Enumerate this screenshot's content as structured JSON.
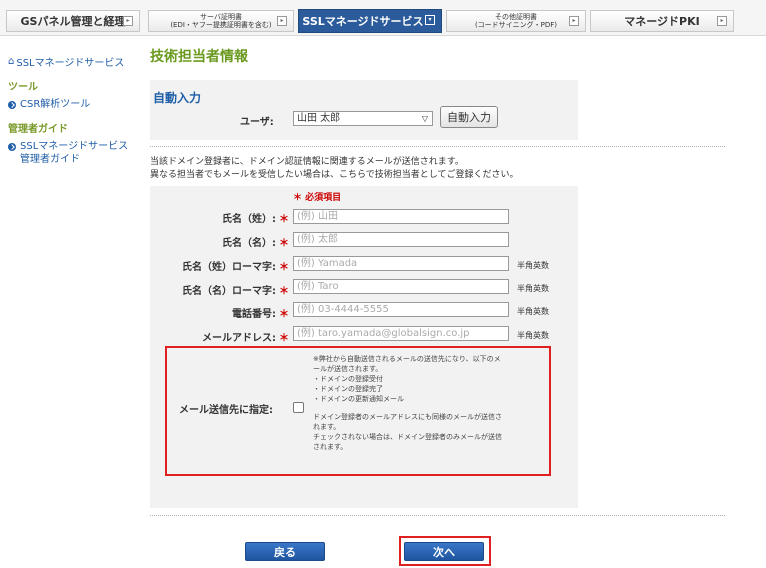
{
  "tabs": [
    {
      "label": "GSパネル管理と経理",
      "small": false,
      "active": false
    },
    {
      "label": "サーバ証明書\n(EDI・ヤフー提携証明書を含む)",
      "small": true,
      "active": false
    },
    {
      "label": "SSLマネージドサービス",
      "small": false,
      "active": true
    },
    {
      "label": "その他証明書\n(コードサイニング・PDF)",
      "small": true,
      "active": false
    },
    {
      "label": "マネージドPKI",
      "small": false,
      "active": false
    }
  ],
  "sidebar": {
    "home": "SSLマネージドサービス",
    "tools_heading": "ツール",
    "csr_link": "CSR解析ツール",
    "admin_heading": "管理者ガイド",
    "admin_link": "SSLマネージドサービス\n管理者ガイド"
  },
  "page": {
    "title": "技術担当者情報"
  },
  "auto_input": {
    "heading": "自動入力",
    "user_label": "ユーザ:",
    "user_selected": "山田 太郎",
    "button": "自動入力"
  },
  "intro": {
    "line1": "当該ドメイン登録者に、ドメイン認証情報に関連するメールが送信されます。",
    "line2": "異なる担当者でもメールを受信したい場合は、こちらで技術担当者としてご登録ください。"
  },
  "required_note": "＊ 必須項目",
  "required_mark": "＊",
  "fields": [
    {
      "label": "氏名（姓）:",
      "placeholder": "(例) 山田",
      "hint": ""
    },
    {
      "label": "氏名（名）:",
      "placeholder": "(例) 太郎",
      "hint": ""
    },
    {
      "label": "氏名（姓）ローマ字:",
      "placeholder": "(例) Yamada",
      "hint": "半角英数"
    },
    {
      "label": "氏名（名）ローマ字:",
      "placeholder": "(例) Taro",
      "hint": "半角英数"
    },
    {
      "label": "電話番号:",
      "placeholder": "(例) 03-4444-5555",
      "hint": "半角英数"
    },
    {
      "label": "メールアドレス:",
      "placeholder": "(例) taro.yamada@globalsign.co.jp",
      "hint": "半角英数"
    }
  ],
  "mail_option": {
    "label": "メール送信先に指定:",
    "checked": false,
    "notes": [
      "※弊社から自動送信されるメールの送信先になり、以下のメ",
      "ールが送信されます。",
      "・ドメインの登録受付",
      "・ドメインの登録完了",
      "・ドメインの更新通知メール",
      "",
      "ドメイン登録者のメールアドレスにも同様のメールが送信さ",
      "れます。",
      "チェックされない場合は、ドメイン登録者のみメールが送信",
      "されます。"
    ]
  },
  "actions": {
    "back": "戻る",
    "next": "次へ"
  },
  "colors": {
    "accent_blue": "#1f5ea8",
    "title_green": "#6a9a1f",
    "required_red": "#cc0000",
    "highlight_red": "#e02020"
  }
}
